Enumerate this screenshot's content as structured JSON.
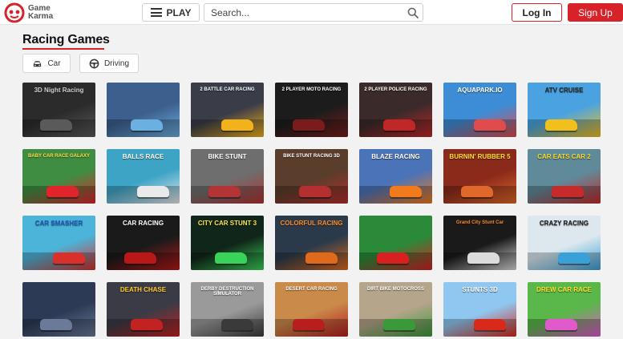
{
  "header": {
    "logo_line1": "Game",
    "logo_line2": "Karma",
    "play_label": "PLAY",
    "search_placeholder": "Search...",
    "login_label": "Log In",
    "signup_label": "Sign Up"
  },
  "page": {
    "title": "Racing Games",
    "chips": [
      {
        "label": "Car",
        "icon": "car-icon"
      },
      {
        "label": "Driving",
        "icon": "steering-wheel-icon"
      }
    ]
  },
  "colors": {
    "brand_red": "#d8222a",
    "background": "#f2f2f2"
  },
  "games": [
    {
      "label": "3D Night Racing",
      "bg": "#2b2b2b",
      "accent": "#5a5a5a",
      "text": "#cfcfcf"
    },
    {
      "label": "",
      "bg": "#3c5f8e",
      "accent": "#6bb0e0",
      "text": "#ffffff"
    },
    {
      "label": "2 BATTLE CAR RACING",
      "bg": "#3a3c48",
      "accent": "#f2b21c",
      "text": "#ffffff"
    },
    {
      "label": "2 PLAYER MOTO RACING",
      "bg": "#1c1c1c",
      "accent": "#7b1c1c",
      "text": "#ffffff"
    },
    {
      "label": "2 PLAYER POLICE RACING",
      "bg": "#3b2a2a",
      "accent": "#c02828",
      "text": "#ffffff"
    },
    {
      "label": "AQUAPARK.IO",
      "bg": "#3d8dd6",
      "accent": "#e14b4b",
      "text": "#ffffff"
    },
    {
      "label": "ATV CRUISE",
      "bg": "#4aa3e0",
      "accent": "#f2c01c",
      "text": "#2a2a2a"
    },
    {
      "label": "BABY CAR RACE GALAXY",
      "bg": "#3f8d43",
      "accent": "#e0242b",
      "text": "#ffe24a"
    },
    {
      "label": "BALLS RACE",
      "bg": "#3ea4c6",
      "accent": "#eaeaea",
      "text": "#ffffff"
    },
    {
      "label": "BIKE STUNT",
      "bg": "#6e6e6e",
      "accent": "#b23434",
      "text": "#ffffff"
    },
    {
      "label": "BIKE STUNT RACING 3D",
      "bg": "#5a3d2a",
      "accent": "#b43030",
      "text": "#ffffff"
    },
    {
      "label": "BLAZE RACING",
      "bg": "#4a73b8",
      "accent": "#f07a1c",
      "text": "#ffffff"
    },
    {
      "label": "BURNIN' RUBBER 5",
      "bg": "#8a2a1a",
      "accent": "#e0682a",
      "text": "#ffdf3a"
    },
    {
      "label": "CAR EATS CAR 2",
      "bg": "#5f8a9a",
      "accent": "#c62a2a",
      "text": "#ffde2a"
    },
    {
      "label": "CAR SMASHER",
      "bg": "#4cb4d8",
      "accent": "#d8302a",
      "text": "#1f5fbf"
    },
    {
      "label": "CAR RACING",
      "bg": "#1a1a1a",
      "accent": "#b81818",
      "text": "#ffffff"
    },
    {
      "label": "CITY CAR STUNT 3",
      "bg": "#10261a",
      "accent": "#3ad35a",
      "text": "#ffe34a"
    },
    {
      "label": "COLORFUL RACING",
      "bg": "#2a3a4a",
      "accent": "#e06a1c",
      "text": "#ff8a2a"
    },
    {
      "label": "",
      "bg": "#2a8a3a",
      "accent": "#d82020",
      "text": "#ffffff"
    },
    {
      "label": "Grand City Stunt Car",
      "bg": "#1a1a1a",
      "accent": "#dcdcdc",
      "text": "#ff8a2a"
    },
    {
      "label": "CRAZY RACING",
      "bg": "#dce8ee",
      "accent": "#3aa0d8",
      "text": "#222222"
    },
    {
      "label": "",
      "bg": "#2c3a56",
      "accent": "#6a7a98",
      "text": "#ffffff"
    },
    {
      "label": "DEATH CHASE",
      "bg": "#3b3b46",
      "accent": "#c22222",
      "text": "#ffcc2a"
    },
    {
      "label": "DERBY DESTRUCTION SIMULATOR",
      "bg": "#9a9a9a",
      "accent": "#3a3a3a",
      "text": "#ffffff"
    },
    {
      "label": "DESERT CAR RACING",
      "bg": "#c98a4a",
      "accent": "#b81e1e",
      "text": "#ffffff"
    },
    {
      "label": "DIRT BIKE MOTOCROSS",
      "bg": "#b5a58a",
      "accent": "#3a9a3a",
      "text": "#ffffff"
    },
    {
      "label": "STUNTS 3D",
      "bg": "#8fc7f0",
      "accent": "#d82a1a",
      "text": "#ffffff"
    },
    {
      "label": "DREW CAR RACE",
      "bg": "#5ab84a",
      "accent": "#e05acb",
      "text": "#ffe22a"
    }
  ]
}
